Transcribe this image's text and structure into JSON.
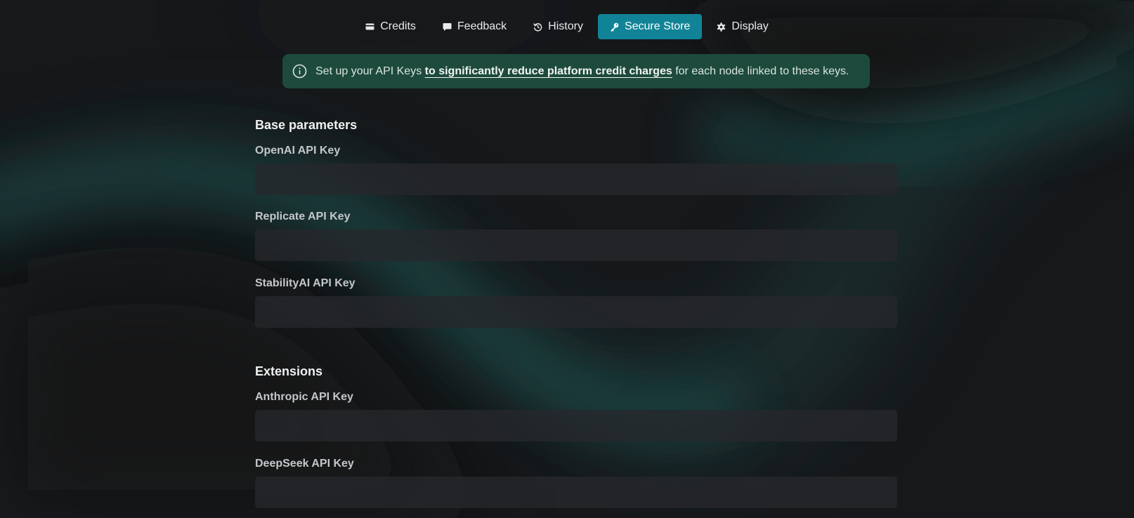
{
  "nav": {
    "items": [
      {
        "label": "Credits",
        "icon": "credit-card-icon",
        "active": false
      },
      {
        "label": "Feedback",
        "icon": "chat-bubble-icon",
        "active": false
      },
      {
        "label": "History",
        "icon": "history-icon",
        "active": false
      },
      {
        "label": "Secure Store",
        "icon": "key-icon",
        "active": true
      },
      {
        "label": "Display",
        "icon": "gear-icon",
        "active": false
      }
    ]
  },
  "banner": {
    "icon": "info-circle-icon",
    "prefix": "Set up your API Keys",
    "link": "to significantly reduce platform credit charges",
    "suffix": "for each node linked to these keys."
  },
  "sections": [
    {
      "title": "Base parameters",
      "fields": [
        {
          "label": "OpenAI API Key",
          "value": "",
          "placeholder": ""
        },
        {
          "label": "Replicate API Key",
          "value": "",
          "placeholder": ""
        },
        {
          "label": "StabilityAI API Key",
          "value": "",
          "placeholder": ""
        }
      ]
    },
    {
      "title": "Extensions",
      "fields": [
        {
          "label": "Anthropic API Key",
          "value": "",
          "placeholder": ""
        },
        {
          "label": "DeepSeek API Key",
          "value": "",
          "placeholder": ""
        }
      ]
    }
  ],
  "colors": {
    "background": "#16181a",
    "accent_active_tab": "#118397",
    "banner_bg": "#1d4a3c",
    "glow": "#1f5c58"
  }
}
